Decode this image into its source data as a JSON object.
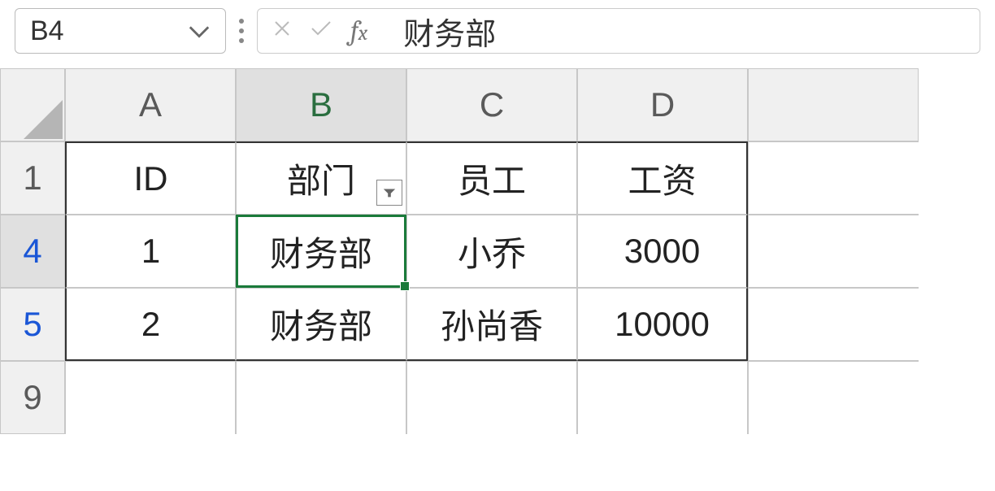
{
  "formula_bar": {
    "cell_ref": "B4",
    "formula_value": "财务部"
  },
  "columns": [
    "A",
    "B",
    "C",
    "D",
    ""
  ],
  "active_column_index": 1,
  "rows": [
    {
      "num": "1",
      "filtered": false,
      "active": false
    },
    {
      "num": "4",
      "filtered": true,
      "active": true
    },
    {
      "num": "5",
      "filtered": true,
      "active": false
    },
    {
      "num": "9",
      "filtered": false,
      "active": false
    }
  ],
  "headers": {
    "A": "ID",
    "B": "部门",
    "C": "员工",
    "D": "工资"
  },
  "data": [
    {
      "A": "1",
      "B": "财务部",
      "C": "小乔",
      "D": "3000"
    },
    {
      "A": "2",
      "B": "财务部",
      "C": "孙尚香",
      "D": "10000"
    }
  ],
  "selected_cell": "B4",
  "filter_on_col": "B"
}
